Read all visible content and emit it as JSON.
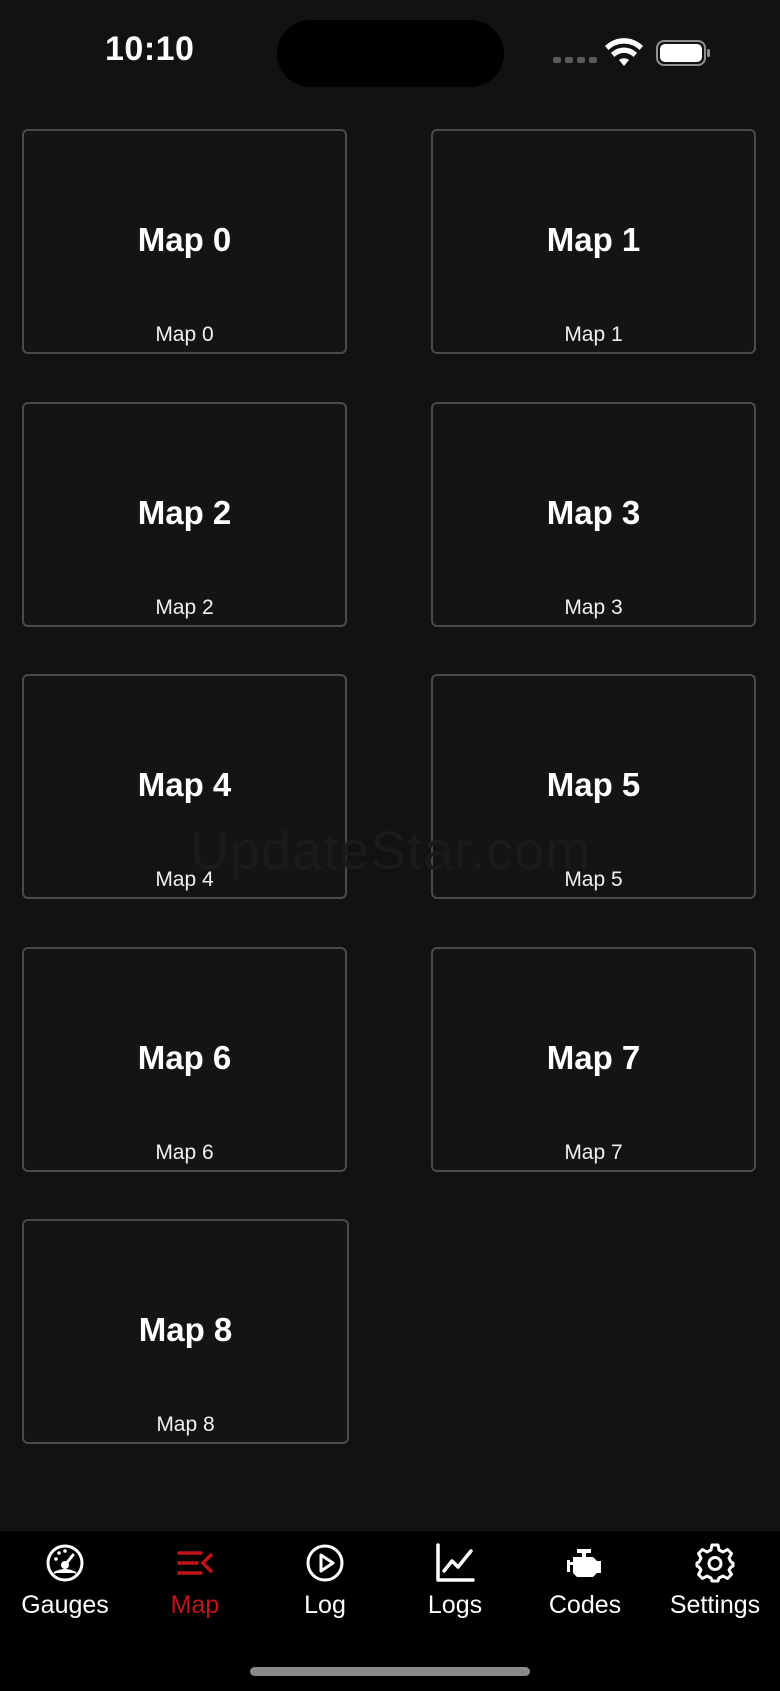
{
  "status_bar": {
    "time": "10:10"
  },
  "watermark": "UpdateStar.com",
  "maps": [
    {
      "title": "Map 0",
      "caption": "Map 0"
    },
    {
      "title": "Map 1",
      "caption": "Map 1"
    },
    {
      "title": "Map 2",
      "caption": "Map 2"
    },
    {
      "title": "Map 3",
      "caption": "Map 3"
    },
    {
      "title": "Map 4",
      "caption": "Map 4"
    },
    {
      "title": "Map 5",
      "caption": "Map 5"
    },
    {
      "title": "Map 6",
      "caption": "Map 6"
    },
    {
      "title": "Map 7",
      "caption": "Map 7"
    },
    {
      "title": "Map 8",
      "caption": "Map 8"
    }
  ],
  "tabs": [
    {
      "label": "Gauges",
      "icon": "gauge-icon",
      "active": false
    },
    {
      "label": "Map",
      "icon": "map-lines-icon",
      "active": true
    },
    {
      "label": "Log",
      "icon": "play-circle-icon",
      "active": false
    },
    {
      "label": "Logs",
      "icon": "line-chart-icon",
      "active": false
    },
    {
      "label": "Codes",
      "icon": "engine-icon",
      "active": false
    },
    {
      "label": "Settings",
      "icon": "gear-icon",
      "active": false
    }
  ],
  "colors": {
    "background": "#121212",
    "card_border": "#4a4a4a",
    "accent_active": "#c0141a",
    "tab_bar": "#000000"
  }
}
